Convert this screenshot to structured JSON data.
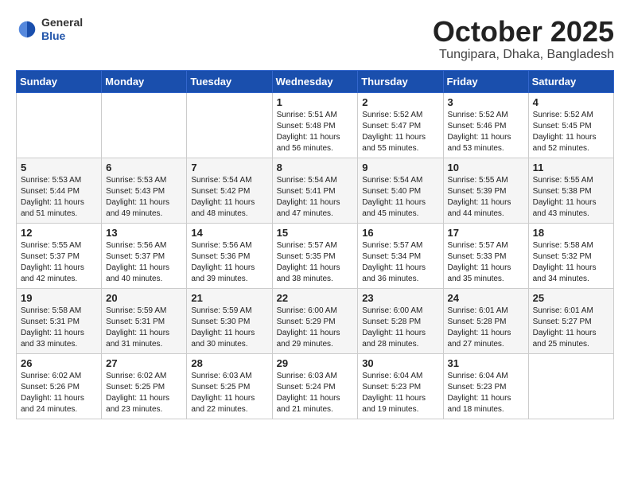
{
  "header": {
    "logo": {
      "general": "General",
      "blue": "Blue"
    },
    "title": "October 2025",
    "location": "Tungipara, Dhaka, Bangladesh"
  },
  "weekdays": [
    "Sunday",
    "Monday",
    "Tuesday",
    "Wednesday",
    "Thursday",
    "Friday",
    "Saturday"
  ],
  "weeks": [
    [
      {
        "day": "",
        "info": ""
      },
      {
        "day": "",
        "info": ""
      },
      {
        "day": "",
        "info": ""
      },
      {
        "day": "1",
        "info": "Sunrise: 5:51 AM\nSunset: 5:48 PM\nDaylight: 11 hours\nand 56 minutes."
      },
      {
        "day": "2",
        "info": "Sunrise: 5:52 AM\nSunset: 5:47 PM\nDaylight: 11 hours\nand 55 minutes."
      },
      {
        "day": "3",
        "info": "Sunrise: 5:52 AM\nSunset: 5:46 PM\nDaylight: 11 hours\nand 53 minutes."
      },
      {
        "day": "4",
        "info": "Sunrise: 5:52 AM\nSunset: 5:45 PM\nDaylight: 11 hours\nand 52 minutes."
      }
    ],
    [
      {
        "day": "5",
        "info": "Sunrise: 5:53 AM\nSunset: 5:44 PM\nDaylight: 11 hours\nand 51 minutes."
      },
      {
        "day": "6",
        "info": "Sunrise: 5:53 AM\nSunset: 5:43 PM\nDaylight: 11 hours\nand 49 minutes."
      },
      {
        "day": "7",
        "info": "Sunrise: 5:54 AM\nSunset: 5:42 PM\nDaylight: 11 hours\nand 48 minutes."
      },
      {
        "day": "8",
        "info": "Sunrise: 5:54 AM\nSunset: 5:41 PM\nDaylight: 11 hours\nand 47 minutes."
      },
      {
        "day": "9",
        "info": "Sunrise: 5:54 AM\nSunset: 5:40 PM\nDaylight: 11 hours\nand 45 minutes."
      },
      {
        "day": "10",
        "info": "Sunrise: 5:55 AM\nSunset: 5:39 PM\nDaylight: 11 hours\nand 44 minutes."
      },
      {
        "day": "11",
        "info": "Sunrise: 5:55 AM\nSunset: 5:38 PM\nDaylight: 11 hours\nand 43 minutes."
      }
    ],
    [
      {
        "day": "12",
        "info": "Sunrise: 5:55 AM\nSunset: 5:37 PM\nDaylight: 11 hours\nand 42 minutes."
      },
      {
        "day": "13",
        "info": "Sunrise: 5:56 AM\nSunset: 5:37 PM\nDaylight: 11 hours\nand 40 minutes."
      },
      {
        "day": "14",
        "info": "Sunrise: 5:56 AM\nSunset: 5:36 PM\nDaylight: 11 hours\nand 39 minutes."
      },
      {
        "day": "15",
        "info": "Sunrise: 5:57 AM\nSunset: 5:35 PM\nDaylight: 11 hours\nand 38 minutes."
      },
      {
        "day": "16",
        "info": "Sunrise: 5:57 AM\nSunset: 5:34 PM\nDaylight: 11 hours\nand 36 minutes."
      },
      {
        "day": "17",
        "info": "Sunrise: 5:57 AM\nSunset: 5:33 PM\nDaylight: 11 hours\nand 35 minutes."
      },
      {
        "day": "18",
        "info": "Sunrise: 5:58 AM\nSunset: 5:32 PM\nDaylight: 11 hours\nand 34 minutes."
      }
    ],
    [
      {
        "day": "19",
        "info": "Sunrise: 5:58 AM\nSunset: 5:31 PM\nDaylight: 11 hours\nand 33 minutes."
      },
      {
        "day": "20",
        "info": "Sunrise: 5:59 AM\nSunset: 5:31 PM\nDaylight: 11 hours\nand 31 minutes."
      },
      {
        "day": "21",
        "info": "Sunrise: 5:59 AM\nSunset: 5:30 PM\nDaylight: 11 hours\nand 30 minutes."
      },
      {
        "day": "22",
        "info": "Sunrise: 6:00 AM\nSunset: 5:29 PM\nDaylight: 11 hours\nand 29 minutes."
      },
      {
        "day": "23",
        "info": "Sunrise: 6:00 AM\nSunset: 5:28 PM\nDaylight: 11 hours\nand 28 minutes."
      },
      {
        "day": "24",
        "info": "Sunrise: 6:01 AM\nSunset: 5:28 PM\nDaylight: 11 hours\nand 27 minutes."
      },
      {
        "day": "25",
        "info": "Sunrise: 6:01 AM\nSunset: 5:27 PM\nDaylight: 11 hours\nand 25 minutes."
      }
    ],
    [
      {
        "day": "26",
        "info": "Sunrise: 6:02 AM\nSunset: 5:26 PM\nDaylight: 11 hours\nand 24 minutes."
      },
      {
        "day": "27",
        "info": "Sunrise: 6:02 AM\nSunset: 5:25 PM\nDaylight: 11 hours\nand 23 minutes."
      },
      {
        "day": "28",
        "info": "Sunrise: 6:03 AM\nSunset: 5:25 PM\nDaylight: 11 hours\nand 22 minutes."
      },
      {
        "day": "29",
        "info": "Sunrise: 6:03 AM\nSunset: 5:24 PM\nDaylight: 11 hours\nand 21 minutes."
      },
      {
        "day": "30",
        "info": "Sunrise: 6:04 AM\nSunset: 5:23 PM\nDaylight: 11 hours\nand 19 minutes."
      },
      {
        "day": "31",
        "info": "Sunrise: 6:04 AM\nSunset: 5:23 PM\nDaylight: 11 hours\nand 18 minutes."
      },
      {
        "day": "",
        "info": ""
      }
    ]
  ]
}
